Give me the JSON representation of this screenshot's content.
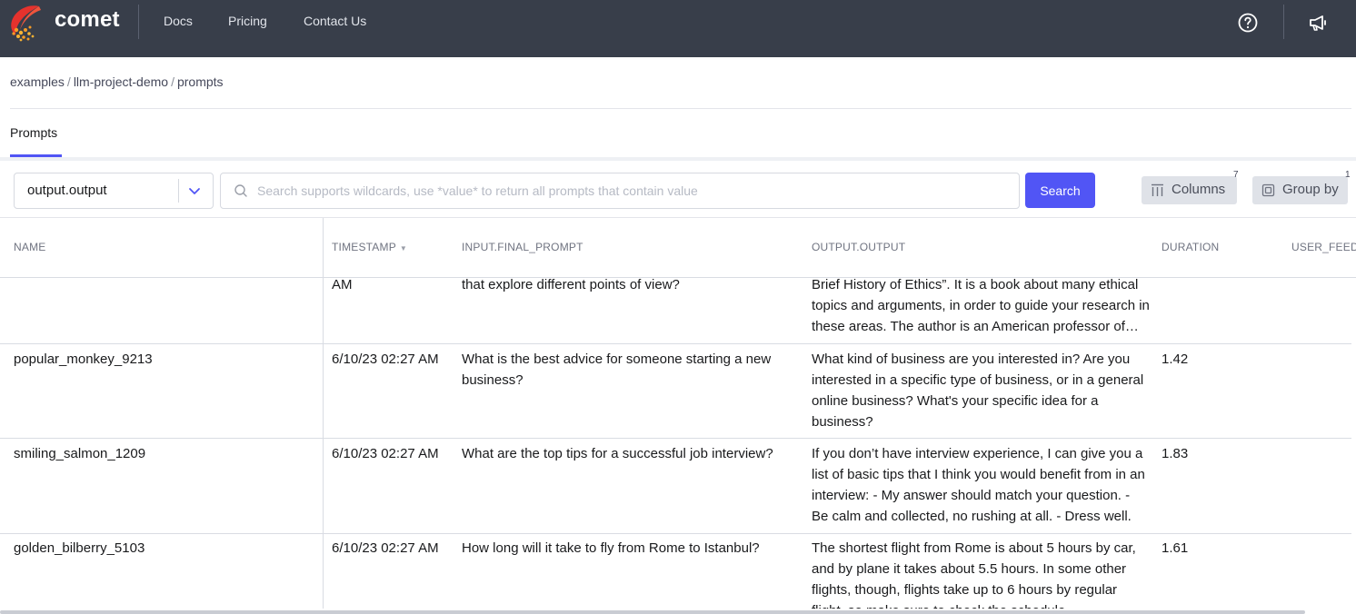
{
  "nav": {
    "brand": "comet",
    "links": [
      "Docs",
      "Pricing",
      "Contact Us"
    ],
    "help_icon": "help-circle-icon",
    "announce_icon": "megaphone-icon"
  },
  "breadcrumb": [
    "examples",
    "llm-project-demo",
    "prompts"
  ],
  "tabs": [
    {
      "label": "Prompts",
      "active": true
    }
  ],
  "toolbar": {
    "column_select_value": "output.output",
    "search_placeholder": "Search supports wildcards, use *value* to return all prompts that contain value",
    "search_label": "Search",
    "columns_label": "Columns",
    "columns_count": "7",
    "groupby_label": "Group by",
    "groupby_count": "1"
  },
  "table": {
    "headers": [
      "NAME",
      "TIMESTAMP",
      "INPUT.FINAL_PROMPT",
      "OUTPUT.OUTPUT",
      "DURATION",
      "USER_FEED"
    ],
    "partial_row": {
      "timestamp": "AM",
      "prompt": "that explore different points of view?",
      "output": "Brief History of Ethics”. It is a book about many ethical topics and arguments, in order to guide your research in these areas. The author is an American professor of philosophy."
    },
    "rows": [
      {
        "name": "popular_monkey_9213",
        "timestamp": "6/10/23 02:27 AM",
        "prompt": "What is the best advice for someone starting a new business?",
        "output": "What kind of business are you interested in? Are you interested in a specific type of business, or in a general online business? What's your specific idea for a business?",
        "duration": "1.42"
      },
      {
        "name": "smiling_salmon_1209",
        "timestamp": "6/10/23 02:27 AM",
        "prompt": "What are the top tips for a successful job interview?",
        "output": "If you don’t have interview experience, I can give you a list of basic tips that I think you would benefit from in an interview: - My answer should match your question. - Be calm and collected, no rushing at all. - Dress well.",
        "duration": "1.83"
      },
      {
        "name": "golden_bilberry_5103",
        "timestamp": "6/10/23 02:27 AM",
        "prompt": "How long will it take to fly from Rome to Istanbul?",
        "output": "The shortest flight from Rome is about 5 hours by car, and by plane it takes about 5.5 hours. In some other flights, though, flights take up to 6 hours by regular flight, so make sure to check the schedule.",
        "duration": "1.61"
      }
    ]
  }
}
